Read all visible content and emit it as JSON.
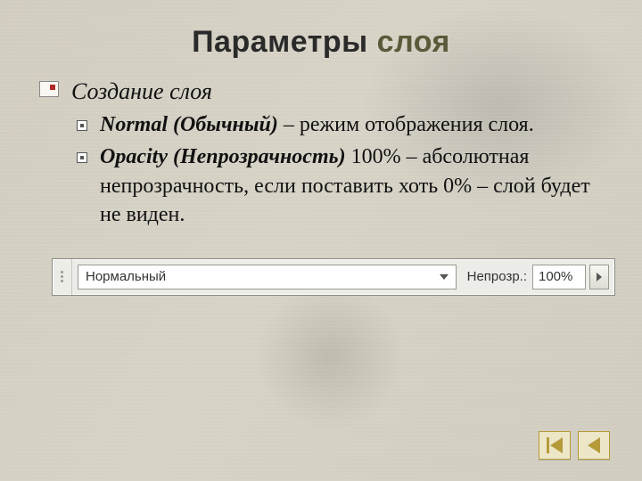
{
  "title": {
    "word1": "Параметры",
    "word2": "слоя"
  },
  "heading": "Создание слоя",
  "items": [
    {
      "bold": "Normal (Обычный)",
      "rest": " – режим отображения слоя."
    },
    {
      "bold": "Opacity (Непрозрачность)",
      "rest": " 100% – абсолютная непрозрачность, если поставить хоть 0% – слой будет не виден."
    }
  ],
  "uibar": {
    "mode_value": "Нормальный",
    "opac_label": "Непрозр.:",
    "opac_value": "100%"
  }
}
